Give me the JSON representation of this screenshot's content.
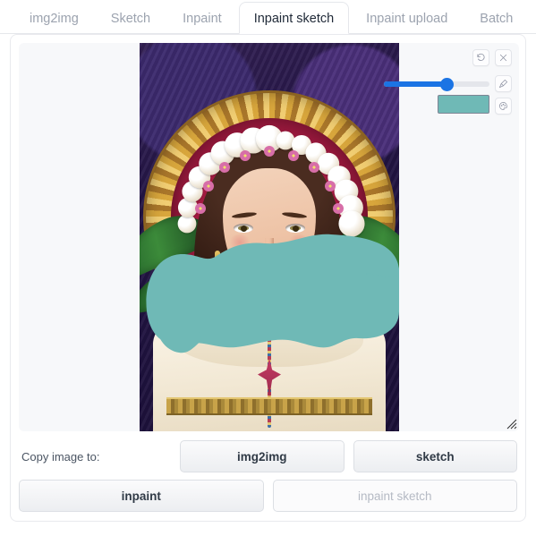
{
  "tabs": [
    {
      "label": "img2img",
      "active": false
    },
    {
      "label": "Sketch",
      "active": false
    },
    {
      "label": "Inpaint",
      "active": false
    },
    {
      "label": "Inpaint sketch",
      "active": true
    },
    {
      "label": "Inpaint upload",
      "active": false
    },
    {
      "label": "Batch",
      "active": false
    }
  ],
  "canvas": {
    "tools": {
      "undo_label": "Undo",
      "clear_label": "Clear",
      "brush_label": "Brush",
      "color_label": "Color palette"
    },
    "brush_size_percent": 60,
    "brush_color": "#6fb9b6",
    "slider_fill_color": "#1b74e4",
    "resize_handle_label": "Resize"
  },
  "copy_section": {
    "label": "Copy image to:",
    "buttons": [
      {
        "label": "img2img",
        "disabled": false
      },
      {
        "label": "sketch",
        "disabled": false
      },
      {
        "label": "inpaint",
        "disabled": false
      },
      {
        "label": "inpaint sketch",
        "disabled": true
      }
    ]
  }
}
